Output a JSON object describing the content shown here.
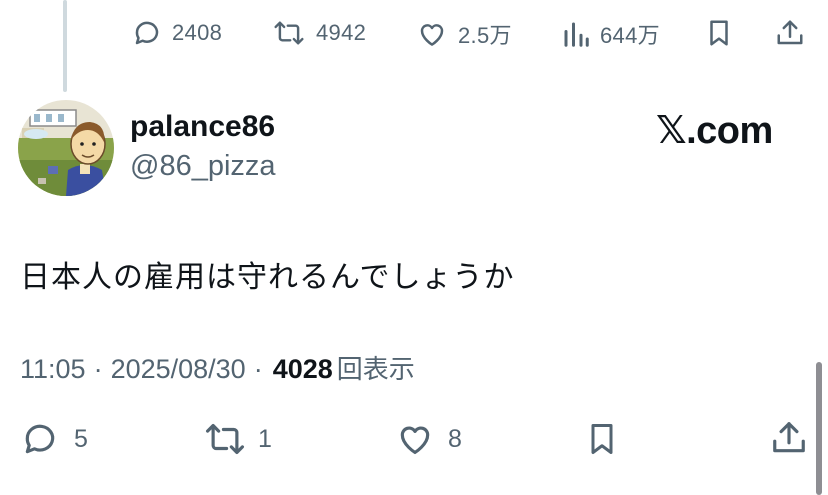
{
  "parent_metrics": {
    "replies": "2408",
    "retweets": "4942",
    "likes": "2.5万",
    "views": "644万"
  },
  "author": {
    "display_name": "palance86",
    "handle": "@86_pizza"
  },
  "brand": "𝕏.com",
  "tweet": {
    "text": "日本人の雇用は守れるんでしょうか"
  },
  "meta": {
    "time": "11:05",
    "sep1": "·",
    "date": "2025/08/30",
    "sep2": "·",
    "views_count": "4028",
    "views_label": "回表示"
  },
  "actions": {
    "replies": "5",
    "retweets": "1",
    "likes": "8"
  },
  "icons": {
    "reply": "reply-bubble-icon",
    "retweet": "retweet-arrows-icon",
    "like": "heart-icon",
    "views": "bar-chart-icon",
    "bookmark": "bookmark-icon",
    "share": "share-upload-icon"
  },
  "colors": {
    "text": "#0f1419",
    "secondary": "#536471",
    "thread_line": "#cfd9de"
  }
}
